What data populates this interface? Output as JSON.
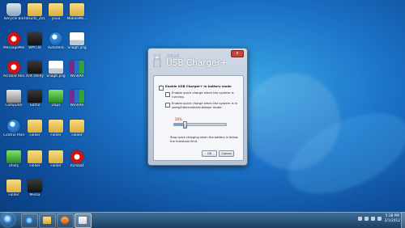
{
  "desktop": {
    "icons": [
      {
        "label": "Recycle Bin",
        "type": "bin",
        "icon": "recycle-bin-icon"
      },
      {
        "label": "Results_201...",
        "type": "folder",
        "icon": "folder-icon"
      },
      {
        "label": "youa",
        "type": "folder",
        "icon": "folder-icon"
      },
      {
        "label": "MobileMe...",
        "type": "folder",
        "icon": "folder-icon"
      },
      {
        "label": "MessageMob 2007",
        "type": "red",
        "icon": "app-icon"
      },
      {
        "label": "WMT.bt",
        "type": "dark",
        "icon": "app-icon"
      },
      {
        "label": "Autodesk",
        "type": "sphere",
        "icon": "app-icon"
      },
      {
        "label": "SnagIt.png",
        "type": "shot",
        "icon": "image-file-icon"
      },
      {
        "label": "Acrobat Reader",
        "type": "red",
        "icon": "app-icon"
      },
      {
        "label": "ATK Utility",
        "type": "dark",
        "icon": "app-icon"
      },
      {
        "label": "SnagIt.png",
        "type": "shot",
        "icon": "image-file-icon"
      },
      {
        "label": "WinRAR",
        "type": "rar",
        "icon": "winrar-icon"
      },
      {
        "label": "Computer",
        "type": "cpu",
        "icon": "computer-icon"
      },
      {
        "label": "Game",
        "type": "dark",
        "icon": "app-icon"
      },
      {
        "label": "Daps",
        "type": "green",
        "icon": "app-icon"
      },
      {
        "label": "WinRAR",
        "type": "rar",
        "icon": "winrar-icon"
      },
      {
        "label": "Control Panel",
        "type": "sphere",
        "icon": "app-icon"
      },
      {
        "label": "Folder",
        "type": "folder",
        "icon": "folder-icon"
      },
      {
        "label": "Folder",
        "type": "folder",
        "icon": "folder-icon"
      },
      {
        "label": "Folder",
        "type": "folder",
        "icon": "folder-icon"
      },
      {
        "label": "Utility",
        "type": "green",
        "icon": "app-icon"
      },
      {
        "label": "Folder",
        "type": "folder",
        "icon": "folder-icon"
      },
      {
        "label": "Folder",
        "type": "folder",
        "icon": "folder-icon"
      },
      {
        "label": "Acrobat",
        "type": "red",
        "icon": "app-icon"
      },
      {
        "label": "Folder",
        "type": "folder",
        "icon": "folder-icon"
      },
      {
        "label": "Media",
        "type": "dark",
        "icon": "app-icon"
      }
    ]
  },
  "dialog": {
    "brand": "/ISUS",
    "title": "USB Charger+",
    "close_label": "x",
    "enable_label": "Enable USB Charger+ in battery mode",
    "quick_running": "Enable quick charge when the system is running.",
    "quick_sleep": "Enable quick charge when the system is in sleep/hibernate/shutdown mode.",
    "percent_label": "20%",
    "percent_value": 0.2,
    "hint": "Stop quick charging when the battery is below the threshold limit.",
    "ok_label": "OK",
    "cancel_label": "Cancel"
  },
  "taskbar": {
    "buttons": [
      {
        "name": "internet-explorer",
        "icon": "ie-icon"
      },
      {
        "name": "file-explorer",
        "icon": "folder-icon"
      },
      {
        "name": "media-player",
        "icon": "media-player-icon"
      },
      {
        "name": "usb-charger",
        "icon": "usb-charger-icon"
      }
    ],
    "time": "5:38 PM",
    "date": "2/1/2012"
  }
}
